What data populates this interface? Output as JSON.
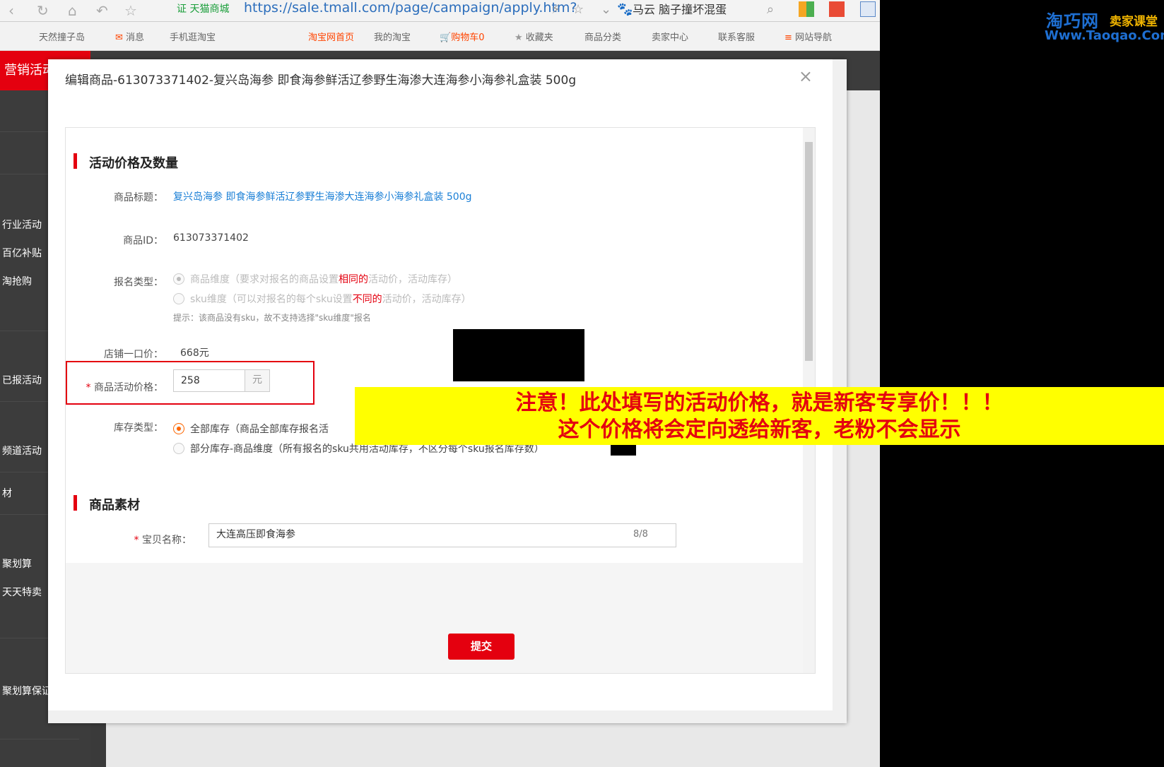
{
  "browser": {
    "badge": "证 天猫商城",
    "url": "https://sale.tmall.com/page/campaign/apply.htm?",
    "site_name": "马云 脑子撞坏混蛋"
  },
  "topnav": {
    "items": [
      "天然撞子岛",
      "消息",
      "手机逛淘宝",
      "淘宝网首页",
      "我的淘宝",
      "购物车0",
      "收藏夹",
      "商品分类",
      "卖家中心",
      "联系客服",
      "网站导航"
    ]
  },
  "brand": "营销活动",
  "sidebar": {
    "items": [
      "行业活动",
      "百亿补贴",
      "淘抢购",
      "已报活动",
      "频道活动",
      "材",
      "聚划算",
      "天天特卖",
      "聚划算保证"
    ]
  },
  "modal": {
    "title": "编辑商品-613073371402-复兴岛海参 即食海参鲜活辽参野生海渗大连海参小海参礼盒装 500g",
    "close": "×",
    "section1": "活动价格及数量",
    "product_title_label": "商品标题：",
    "product_title": "复兴岛海参 即食海参鲜活辽参野生海渗大连海参小海参礼盒装 500g",
    "product_id_label": "商品ID：",
    "product_id": "613073371402",
    "signup_type_label": "报名类型：",
    "option1_a": "商品维度（要求对报名的商品设置",
    "option1_b": "相同的",
    "option1_c": "活动价，活动库存）",
    "option2_a": "sku维度（可以对报名的每个sku设置",
    "option2_b": "不同的",
    "option2_c": "活动价，活动库存）",
    "hint": "提示：该商品没有sku，故不支持选择\"sku维度\"报名",
    "shop_price_label": "店铺一口价：",
    "shop_price": "668元",
    "activity_price_label": "商品活动价格：",
    "activity_price": "258",
    "price_unit": "元",
    "stock_type_label": "库存类型：",
    "stock_option1": "全部库存（商品全部库存报名活",
    "stock_option2": "部分库存-商品维度（所有报名的sku共用活动库存，不区分每个sku报名库存数）",
    "section2": "商品素材",
    "item_name_label": "宝贝名称：",
    "item_name": "大连高压即食海参",
    "item_name_count": "8/8",
    "submit": "提交"
  },
  "notice": {
    "line1": "注意！此处填写的活动价格，就是新客专享价！！！",
    "line2": "这个价格将会定向透给新客，老粉不会显示"
  },
  "watermark": {
    "logo": "淘巧网",
    "tag": "卖家课堂",
    "site": "Www.Taoqao.Com"
  }
}
